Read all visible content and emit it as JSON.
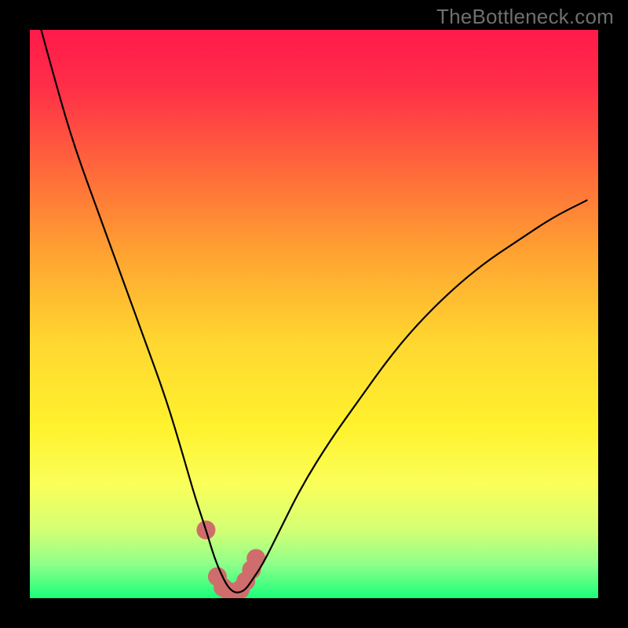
{
  "watermark": {
    "text": "TheBottleneck.com"
  },
  "colors": {
    "gradient_stops": [
      {
        "offset": 0.0,
        "color": "#ff1a4b"
      },
      {
        "offset": 0.1,
        "color": "#ff2e48"
      },
      {
        "offset": 0.25,
        "color": "#ff6a3a"
      },
      {
        "offset": 0.4,
        "color": "#ffa531"
      },
      {
        "offset": 0.55,
        "color": "#ffd730"
      },
      {
        "offset": 0.7,
        "color": "#fff22e"
      },
      {
        "offset": 0.8,
        "color": "#faff5a"
      },
      {
        "offset": 0.88,
        "color": "#d4ff74"
      },
      {
        "offset": 0.94,
        "color": "#8fff8a"
      },
      {
        "offset": 1.0,
        "color": "#1aff7a"
      }
    ],
    "curve": "#000000",
    "marker": "#cf6d6c",
    "frame": "#000000"
  },
  "chart_data": {
    "type": "line",
    "title": "",
    "xlabel": "",
    "ylabel": "",
    "xlim": [
      0,
      100
    ],
    "ylim": [
      0,
      100
    ],
    "series": [
      {
        "name": "bottleneck-curve",
        "x": [
          2,
          5,
          8,
          12,
          16,
          20,
          24,
          27,
          29,
          31,
          32.5,
          34,
          35,
          36,
          37,
          38,
          39,
          41,
          44,
          48,
          53,
          58,
          63,
          68,
          74,
          80,
          86,
          92,
          98
        ],
        "y": [
          100,
          89,
          79,
          68,
          57,
          46,
          35,
          25,
          18,
          12,
          7,
          3.5,
          1.8,
          1.0,
          1.0,
          1.6,
          3.0,
          6.0,
          12,
          20,
          28,
          35,
          42,
          48,
          54,
          59,
          63,
          67,
          70
        ]
      }
    ],
    "markers": {
      "name": "highlight-band",
      "x": [
        31.0,
        33.0,
        34.0,
        35.0,
        36.0,
        37.0,
        38.0,
        39.0,
        39.8
      ],
      "y": [
        12.0,
        3.8,
        1.9,
        1.2,
        1.0,
        1.5,
        3.0,
        5.0,
        7.0
      ],
      "radius": 12
    }
  }
}
